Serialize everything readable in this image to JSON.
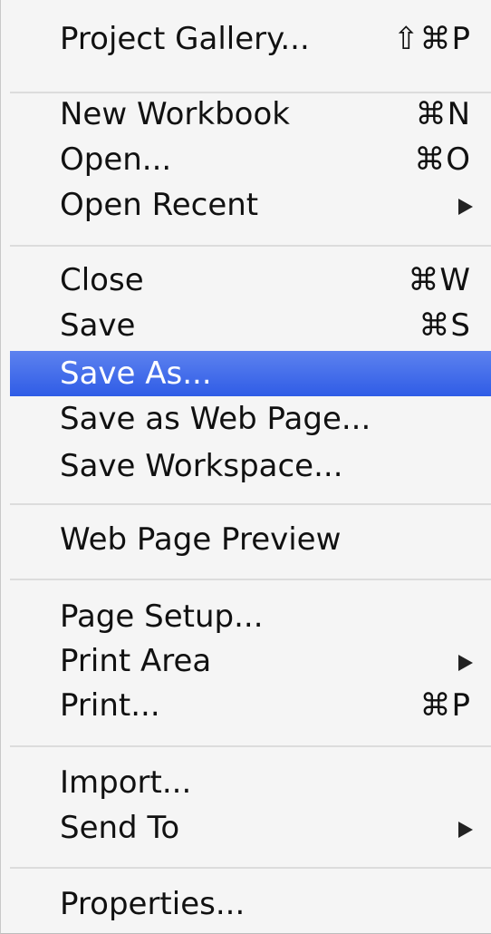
{
  "menu": {
    "items": {
      "project_gallery": {
        "label": "Project Gallery...",
        "shortcut": "⇧⌘P"
      },
      "new_workbook": {
        "label": "New Workbook",
        "shortcut": "⌘N"
      },
      "open": {
        "label": "Open...",
        "shortcut": "⌘O"
      },
      "open_recent": {
        "label": "Open Recent",
        "submenu_icon": "triangle-right-icon"
      },
      "close": {
        "label": "Close",
        "shortcut": "⌘W"
      },
      "save": {
        "label": "Save",
        "shortcut": "⌘S"
      },
      "save_as": {
        "label": "Save As...",
        "highlighted": true
      },
      "save_as_web_page": {
        "label": "Save as Web Page..."
      },
      "save_workspace": {
        "label": "Save Workspace..."
      },
      "web_page_preview": {
        "label": "Web Page Preview"
      },
      "page_setup": {
        "label": "Page Setup..."
      },
      "print_area": {
        "label": "Print Area",
        "submenu_icon": "triangle-right-icon"
      },
      "print": {
        "label": "Print...",
        "shortcut": "⌘P"
      },
      "import": {
        "label": "Import..."
      },
      "send_to": {
        "label": "Send To",
        "submenu_icon": "triangle-right-icon"
      },
      "properties": {
        "label": "Properties..."
      }
    }
  },
  "colors": {
    "highlight": "#3a65e8",
    "menu_background": "#f5f5f5",
    "separator": "#dcdcdc"
  }
}
